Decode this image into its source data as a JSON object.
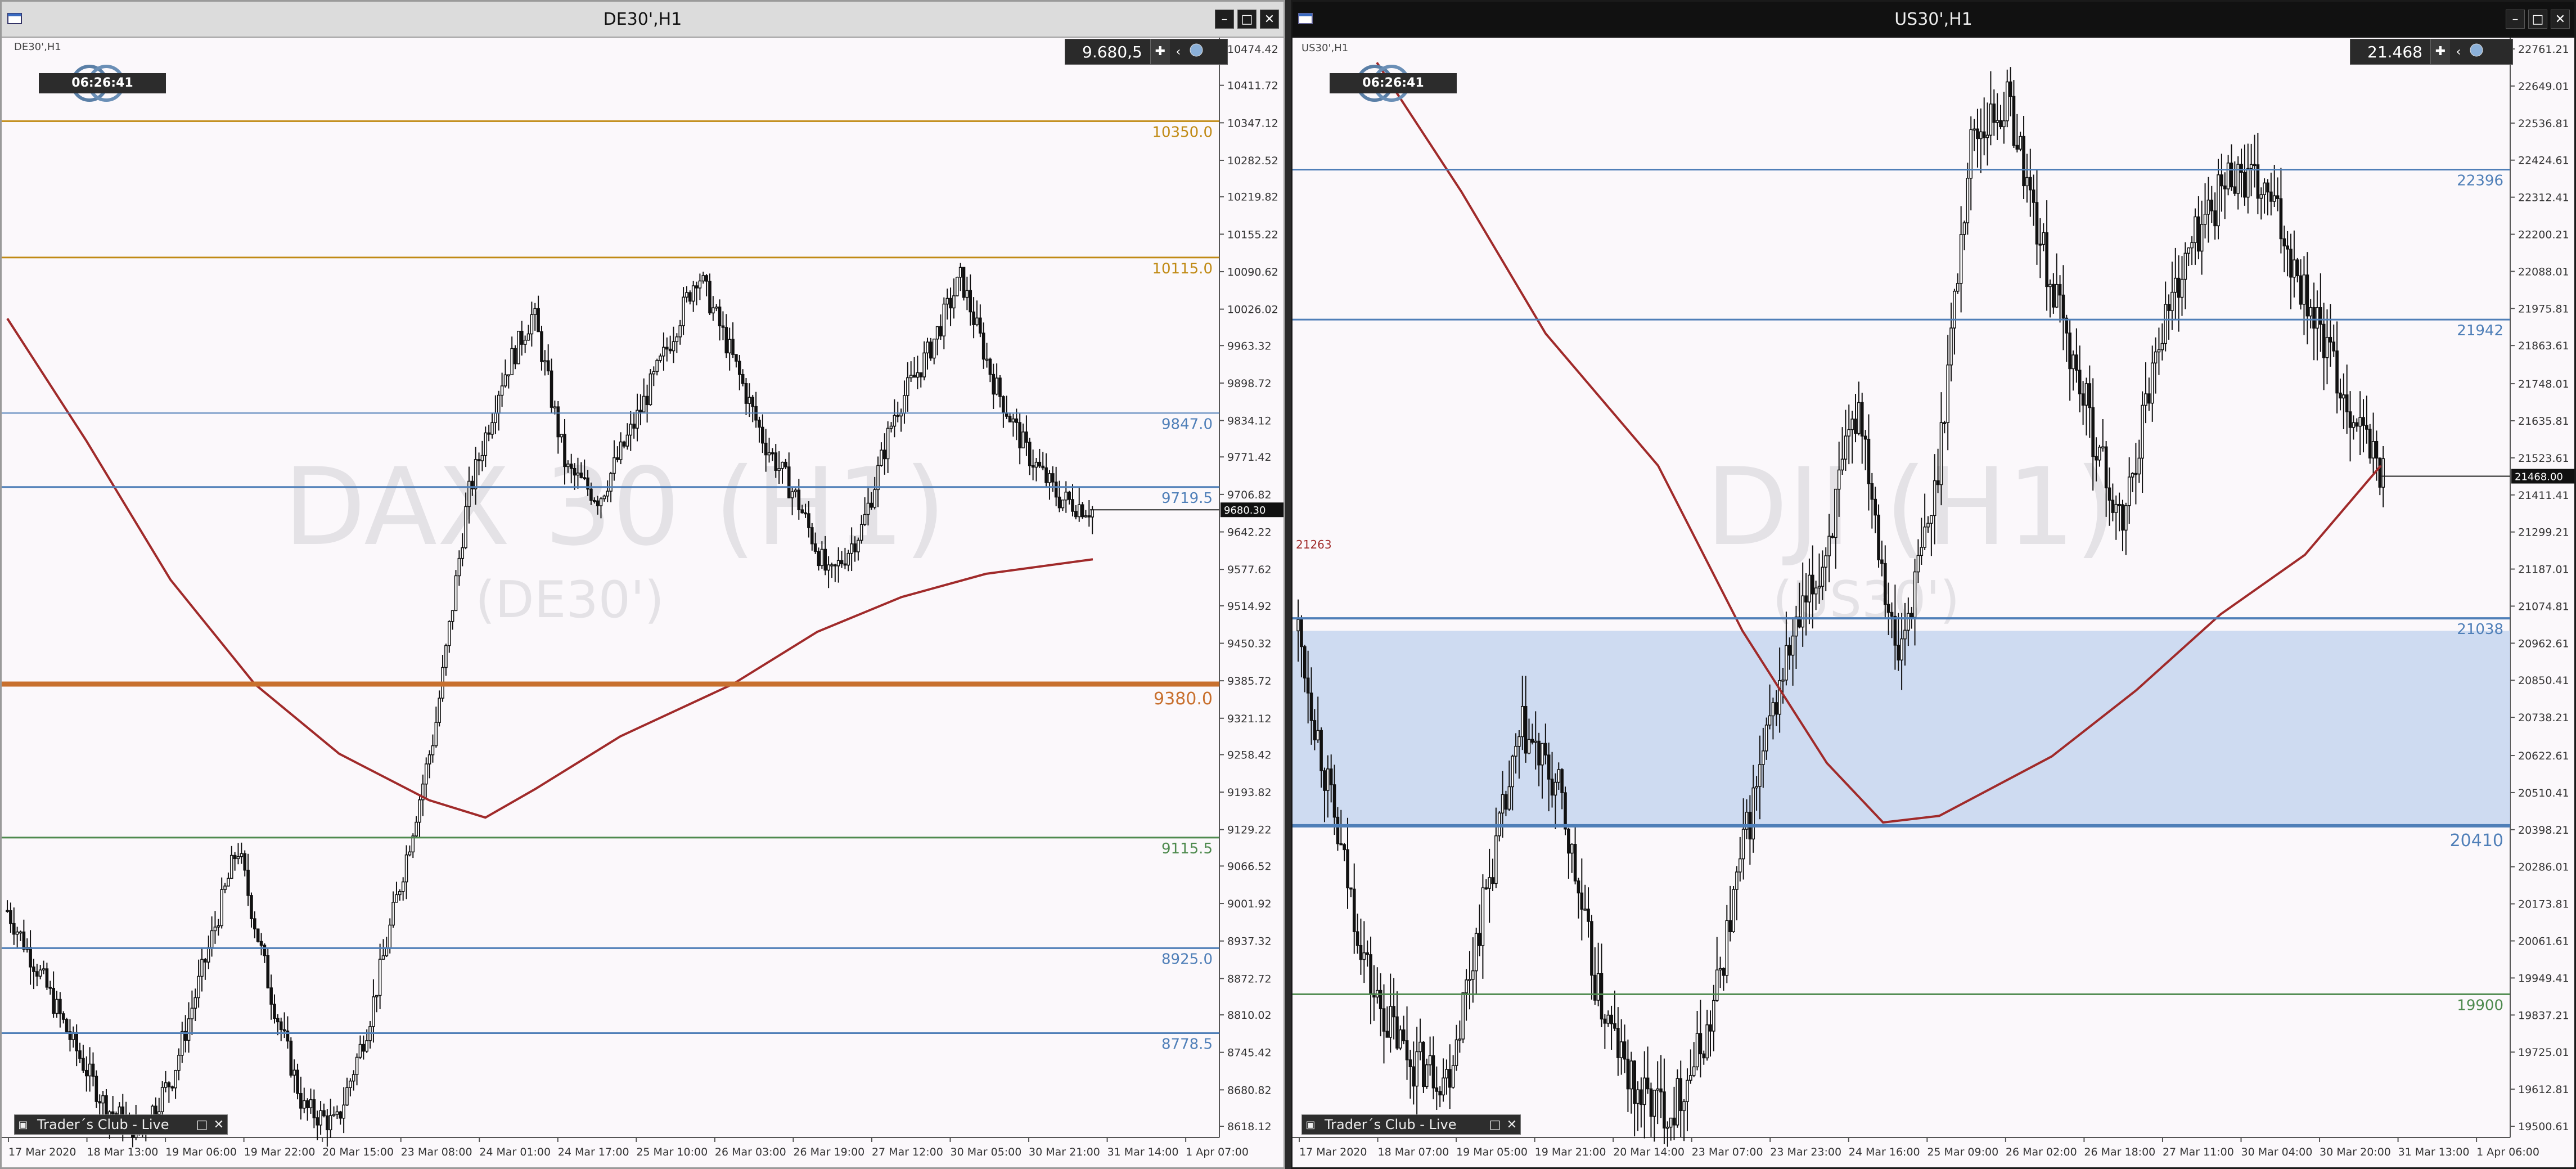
{
  "left": {
    "window_title": "DE30',H1",
    "symbol_tag": "DE30',H1",
    "watermark_main": "DAX 30 (H1)",
    "watermark_sub": "(DE30')",
    "price_box": "9.680,5",
    "timer": "06:26:41",
    "current_price_label": "9680.30",
    "taskbar_label": "Trader´s Club - Live",
    "y_ticks": [
      "10474.42",
      "10411.72",
      "10347.12",
      "10282.52",
      "10219.82",
      "10155.22",
      "10090.62",
      "10026.02",
      "9963.32",
      "9898.72",
      "9834.12",
      "9771.42",
      "9706.82",
      "9642.22",
      "9577.62",
      "9514.92",
      "9450.32",
      "9385.72",
      "9321.12",
      "9258.42",
      "9193.82",
      "9129.22",
      "9066.52",
      "9001.92",
      "8937.32",
      "8872.72",
      "8810.02",
      "8745.42",
      "8680.82",
      "8618.12"
    ],
    "x_ticks": [
      "17 Mar 2020",
      "18 Mar 13:00",
      "19 Mar 06:00",
      "19 Mar 22:00",
      "20 Mar 15:00",
      "23 Mar 08:00",
      "24 Mar 01:00",
      "24 Mar 17:00",
      "25 Mar 10:00",
      "26 Mar 03:00",
      "26 Mar 19:00",
      "27 Mar 12:00",
      "30 Mar 05:00",
      "30 Mar 21:00",
      "31 Mar 14:00",
      "1 Apr 07:00"
    ],
    "levels": [
      {
        "label": "10350.0",
        "color": "#c08a14",
        "y": 10350,
        "width": 3
      },
      {
        "label": "10115.0",
        "color": "#c08a14",
        "y": 10115,
        "width": 3
      },
      {
        "label": "9847.0",
        "color": "#4f7fb8",
        "y": 9847,
        "width": 2
      },
      {
        "label": "9719.5",
        "color": "#4f7fb8",
        "y": 9719.5,
        "width": 3
      },
      {
        "label": "9380.0",
        "color": "#c8702e",
        "y": 9380,
        "width": 9
      },
      {
        "label": "9115.5",
        "color": "#4e8a4e",
        "y": 9115.5,
        "width": 3
      },
      {
        "label": "8925.0",
        "color": "#4f7fb8",
        "y": 8925,
        "width": 3
      },
      {
        "label": "8778.5",
        "color": "#4f7fb8",
        "y": 8778.5,
        "width": 3
      }
    ]
  },
  "right": {
    "window_title": "US30',H1",
    "symbol_tag": "US30',H1",
    "watermark_main": "DJI (H1)",
    "watermark_sub": "(US30')",
    "price_box": "21.468",
    "timer": "06:26:41",
    "current_price_label": "21468.00",
    "side_marker": "21263",
    "taskbar_label": "Trader´s Club - Live",
    "y_ticks": [
      "22761.21",
      "22649.01",
      "22536.81",
      "22424.61",
      "22312.41",
      "22200.21",
      "22088.01",
      "21975.81",
      "21863.61",
      "21748.01",
      "21635.81",
      "21523.61",
      "21411.41",
      "21299.21",
      "21187.01",
      "21074.81",
      "20962.61",
      "20850.41",
      "20738.21",
      "20622.61",
      "20510.41",
      "20398.21",
      "20286.01",
      "20173.81",
      "20061.61",
      "19949.41",
      "19837.21",
      "19725.01",
      "19612.81",
      "19500.61"
    ],
    "x_ticks": [
      "17 Mar 2020",
      "18 Mar 07:00",
      "19 Mar 05:00",
      "19 Mar 21:00",
      "20 Mar 14:00",
      "23 Mar 07:00",
      "23 Mar 23:00",
      "24 Mar 16:00",
      "25 Mar 09:00",
      "26 Mar 02:00",
      "26 Mar 18:00",
      "27 Mar 11:00",
      "30 Mar 04:00",
      "30 Mar 20:00",
      "31 Mar 13:00",
      "1 Apr 06:00"
    ],
    "levels": [
      {
        "label": "22396",
        "color": "#4f7fb8",
        "y": 22396,
        "width": 3
      },
      {
        "label": "21942",
        "color": "#4f7fb8",
        "y": 21942,
        "width": 3
      },
      {
        "label": "21038",
        "color": "#4f7fb8",
        "y": 21038,
        "width": 4
      },
      {
        "label": "20410",
        "color": "#4f7fb8",
        "y": 20410,
        "width": 6
      },
      {
        "label": "19900",
        "color": "#4e8a4e",
        "y": 19900,
        "width": 3
      }
    ],
    "zone": {
      "from": 20410,
      "to": 21000,
      "color": "#c5d6ee"
    }
  },
  "colors": {
    "ma": "#a02a2a",
    "candle": "#111111",
    "grid": "#cfcfcf",
    "axis_text": "#333333"
  }
}
